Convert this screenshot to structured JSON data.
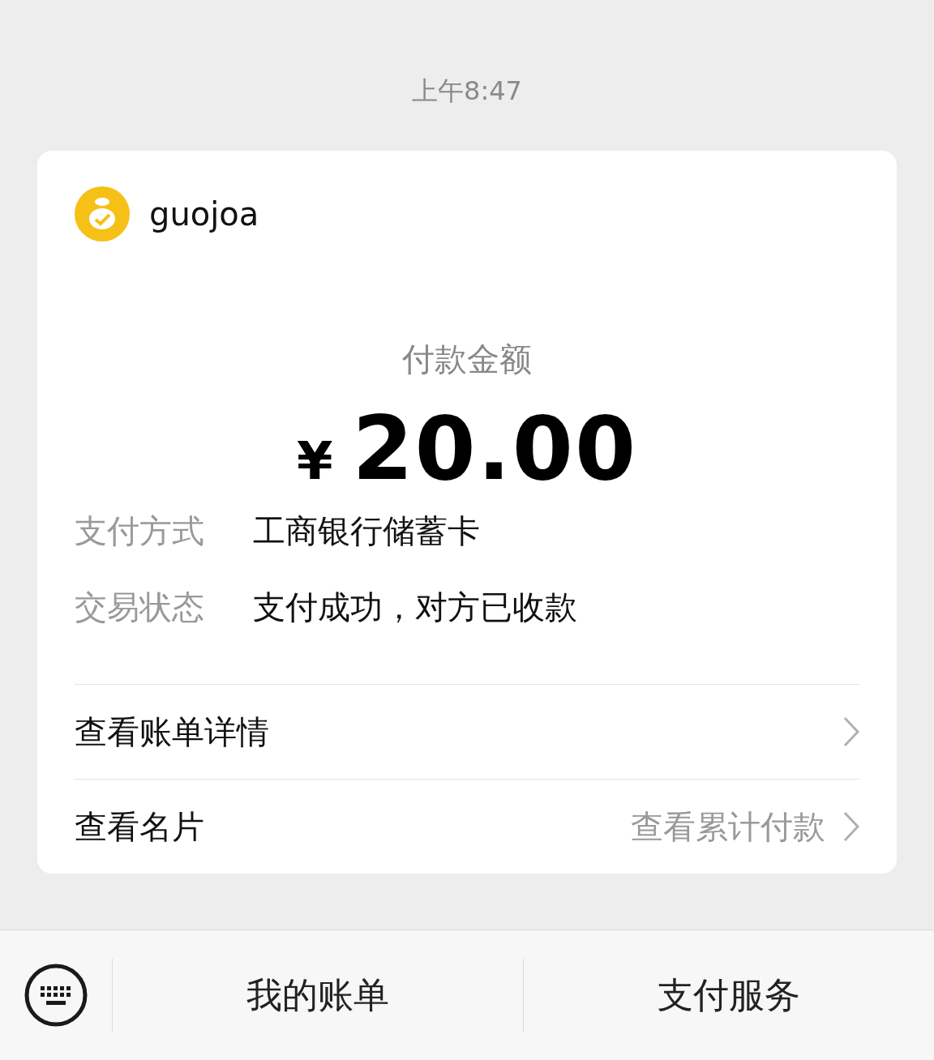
{
  "timestamp": "上午8:47",
  "card": {
    "merchant": "guojoa",
    "amount_label": "付款金额",
    "currency": "¥",
    "amount": "20.00",
    "details": [
      {
        "label": "支付方式",
        "value": "工商银行储蓄卡"
      },
      {
        "label": "交易状态",
        "value": "支付成功，对方已收款"
      }
    ],
    "links": [
      {
        "label": "查看账单详情"
      },
      {
        "label": "查看名片",
        "hint": "查看累计付款"
      }
    ]
  },
  "bottom_bar": {
    "buttons": [
      "我的账单",
      "支付服务"
    ]
  }
}
